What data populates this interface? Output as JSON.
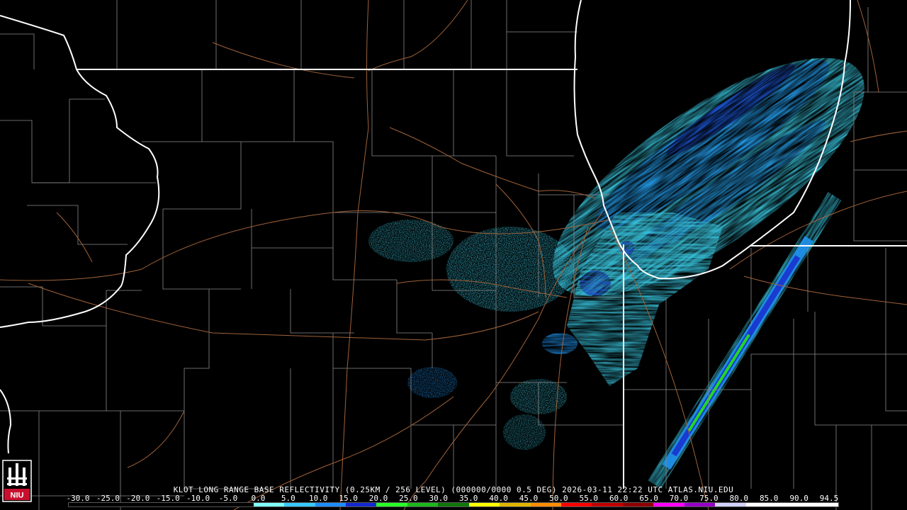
{
  "title": "KLOT LONG RANGE BASE REFLECTIVITY (0.25KM / 256 LEVEL) (000000/0000 0.5 DEG) 2026-03-11 22:22 UTC  ATLAS.NIU.EDU",
  "logo": {
    "text": "NIU",
    "color": "#c8102e"
  },
  "scale": {
    "labels": [
      "-30.0",
      "-25.0",
      "-20.0",
      "-15.0",
      "-10.0",
      "-5.0",
      "0.0",
      "5.0",
      "10.0",
      "15.0",
      "20.0",
      "25.0",
      "30.0",
      "35.0",
      "40.0",
      "45.0",
      "50.0",
      "55.0",
      "60.0",
      "65.0",
      "70.0",
      "75.0",
      "80.0",
      "85.0",
      "90.0",
      "94.5"
    ],
    "colors": [
      "#000000",
      "#000000",
      "#000000",
      "#000000",
      "#000000",
      "#000000",
      "#7fffff",
      "#37c9ff",
      "#1e8cff",
      "#1428d0",
      "#28ff28",
      "#1cb81c",
      "#10780a",
      "#ffff00",
      "#e0b400",
      "#ff8c00",
      "#ff0000",
      "#c00000",
      "#900000",
      "#ff00ff",
      "#9600c8",
      "#d2d2ff",
      "#ffffff",
      "#ffffff",
      "#ffffff"
    ]
  },
  "radar": {
    "palette": {
      "light": "#39c7e0",
      "mid": "#1f8fe8",
      "dark": "#1a3ad0",
      "green": "#22d822"
    }
  }
}
